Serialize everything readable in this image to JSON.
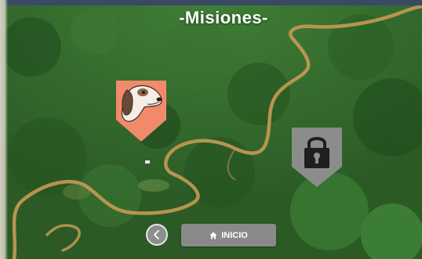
{
  "title": "-Misiones-",
  "missions": [
    {
      "icon": "dog-icon",
      "locked": false,
      "color": "#f08a6b"
    },
    {
      "icon": "lock-icon",
      "locked": true,
      "color": "#8f8f8f"
    }
  ],
  "nav": {
    "back_icon": "chevron-left-icon",
    "home_icon": "home-icon",
    "home_label": "INICIO"
  }
}
